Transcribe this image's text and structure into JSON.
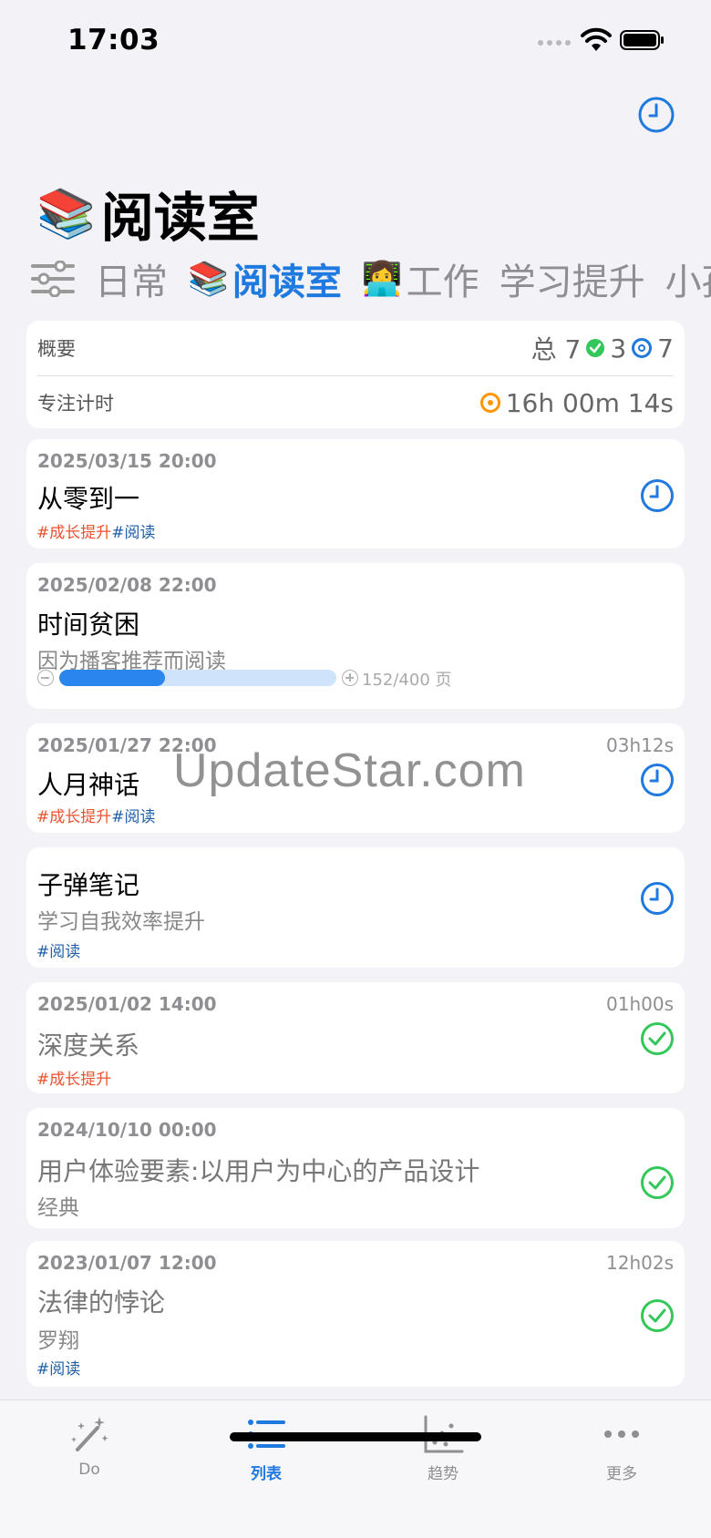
{
  "status": {
    "time": "17:03"
  },
  "header": {
    "emoji": "📚",
    "title": "阅读室"
  },
  "tabs": [
    {
      "emoji": "",
      "label": "日常"
    },
    {
      "emoji": "📚",
      "label": "阅读室"
    },
    {
      "emoji": "👩‍💻",
      "label": "工作"
    },
    {
      "emoji": "",
      "label": "学习提升"
    },
    {
      "emoji": "",
      "label": "小孩"
    }
  ],
  "summary": {
    "overview_label": "概要",
    "total_text": "总 7",
    "done_count": "3",
    "target_count": "7",
    "focus_label": "专注计时",
    "focus_time": "16h 00m 14s"
  },
  "cards": [
    {
      "date": "2025/03/15 20:00",
      "duration": "",
      "title": "从零到一",
      "subtitle": "",
      "tags": [
        "#成长提升",
        "#阅读"
      ],
      "status": "pending"
    },
    {
      "date": "2025/02/08 22:00",
      "duration": "",
      "title": "时间贫困",
      "subtitle": "因为播客推荐而阅读",
      "tags": [],
      "status": "progress",
      "progress": {
        "current": 152,
        "total": 400,
        "text": "152/400 页",
        "fraction": 0.38
      }
    },
    {
      "date": "2025/01/27 22:00",
      "duration": "03h12s",
      "title": "人月神话",
      "subtitle": "",
      "tags": [
        "#成长提升",
        "#阅读"
      ],
      "status": "pending"
    },
    {
      "date": "",
      "duration": "",
      "title": "子弹笔记",
      "subtitle": "学习自我效率提升",
      "tags": [
        "#阅读"
      ],
      "status": "pending"
    },
    {
      "date": "2025/01/02 14:00",
      "duration": "01h00s",
      "title": "深度关系",
      "subtitle": "",
      "tags": [
        "#成长提升"
      ],
      "status": "done"
    },
    {
      "date": "2024/10/10 00:00",
      "duration": "",
      "title": "用户体验要素:以用户为中心的产品设计",
      "subtitle": "经典",
      "tags": [],
      "status": "done"
    },
    {
      "date": "2023/01/07 12:00",
      "duration": "12h02s",
      "title": "法律的悖论",
      "subtitle": "罗翔",
      "tags": [
        "#阅读"
      ],
      "status": "done"
    }
  ],
  "watermark": "UpdateStar.com",
  "tabbar": [
    {
      "label": "Do",
      "icon": "magic-wand-icon"
    },
    {
      "label": "列表",
      "icon": "list-icon"
    },
    {
      "label": "趋势",
      "icon": "scatter-chart-icon"
    },
    {
      "label": "更多",
      "icon": "more-icon"
    }
  ],
  "colors": {
    "accent": "#1f7ae0",
    "done": "#34c759",
    "timer": "#ff9500",
    "tag_growth": "#e8542d",
    "tag_read": "#1f5fa8"
  }
}
